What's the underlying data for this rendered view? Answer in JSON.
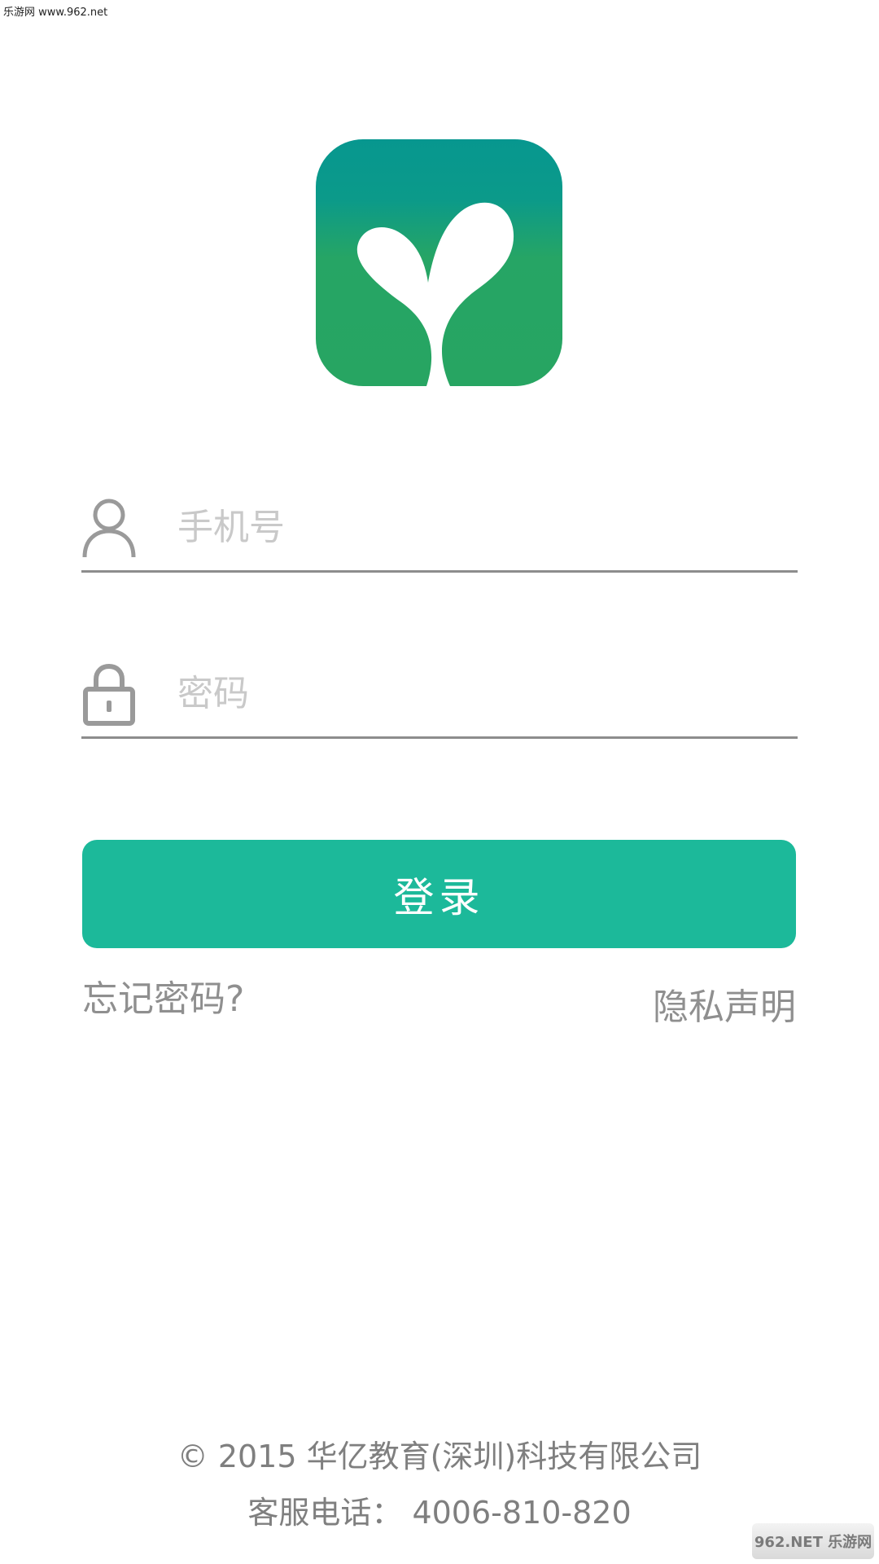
{
  "watermark": {
    "top_text": "乐游网 www.962.net",
    "bottom_text": "962.NET 乐游网"
  },
  "app": {
    "logo_icon": "sprout-logo-icon",
    "brand_gradient_top": "#07978f",
    "brand_gradient_bottom": "#27a562"
  },
  "form": {
    "phone": {
      "icon": "user-icon",
      "value": "",
      "placeholder": "手机号"
    },
    "password": {
      "icon": "lock-icon",
      "value": "",
      "placeholder": "密码"
    },
    "login_label": "登录",
    "login_color": "#1cb99a"
  },
  "links": {
    "forgot_password": "忘记密码?",
    "privacy": "隐私声明"
  },
  "footer": {
    "copyright": "© 2015 华亿教育(深圳)科技有限公司",
    "phone": "客服电话：  4006-810-820"
  }
}
